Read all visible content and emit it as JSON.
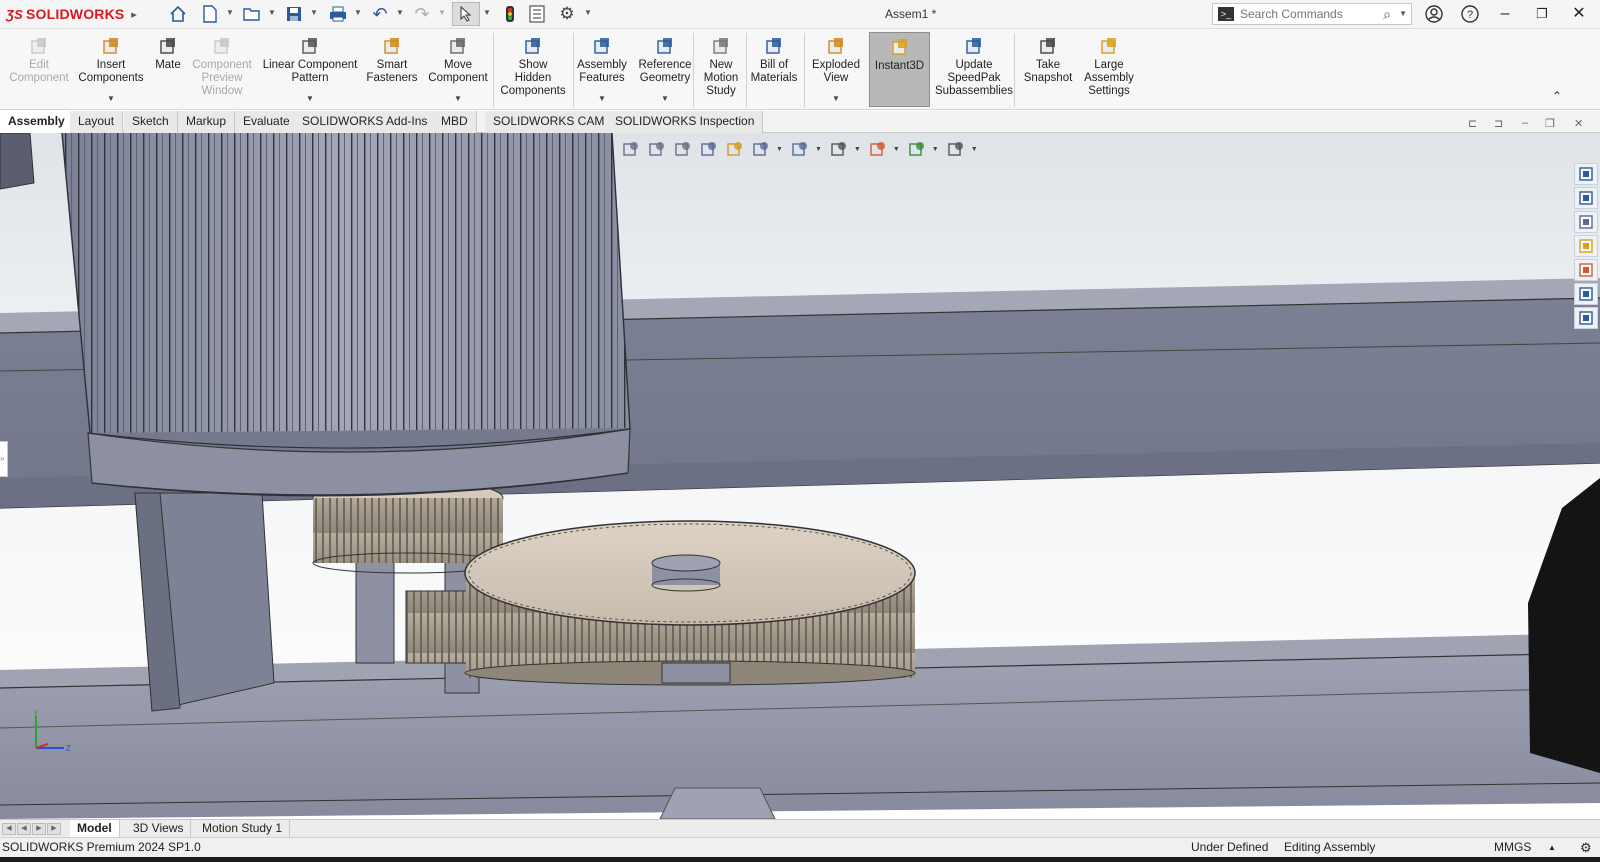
{
  "app": {
    "brand": "SOLIDWORKS",
    "document_title": "Assem1 *"
  },
  "search": {
    "placeholder": "Search Commands"
  },
  "ribbon": {
    "commands": [
      {
        "label": "Edit Component",
        "lines": [
          "Edit",
          "Component"
        ],
        "icon": "edit-component-icon",
        "enabled": false
      },
      {
        "label": "Insert Components",
        "lines": [
          "Insert",
          "Components"
        ],
        "icon": "insert-components-icon",
        "enabled": true,
        "dropdown": true
      },
      {
        "label": "Mate",
        "lines": [
          "Mate"
        ],
        "icon": "mate-icon",
        "enabled": true
      },
      {
        "label": "Component Preview Window",
        "lines": [
          "Component",
          "Preview",
          "Window"
        ],
        "icon": "preview-window-icon",
        "enabled": false
      },
      {
        "label": "Linear Component Pattern",
        "lines": [
          "Linear Component",
          "Pattern"
        ],
        "icon": "linear-pattern-icon",
        "enabled": true,
        "dropdown": true
      },
      {
        "label": "Smart Fasteners",
        "lines": [
          "Smart",
          "Fasteners"
        ],
        "icon": "smart-fasteners-icon",
        "enabled": true
      },
      {
        "label": "Move Component",
        "lines": [
          "Move",
          "Component"
        ],
        "icon": "move-component-icon",
        "enabled": true,
        "dropdown": true
      },
      {
        "label": "Show Hidden Components",
        "lines": [
          "Show",
          "Hidden",
          "Components"
        ],
        "icon": "show-hidden-icon",
        "enabled": true
      },
      {
        "label": "Assembly Features",
        "lines": [
          "Assembly",
          "Features"
        ],
        "icon": "assembly-features-icon",
        "enabled": true,
        "dropdown": true
      },
      {
        "label": "Reference Geometry",
        "lines": [
          "Reference",
          "Geometry"
        ],
        "icon": "reference-geometry-icon",
        "enabled": true,
        "dropdown": true
      },
      {
        "label": "New Motion Study",
        "lines": [
          "New",
          "Motion",
          "Study"
        ],
        "icon": "motion-study-icon",
        "enabled": true
      },
      {
        "label": "Bill of Materials",
        "lines": [
          "Bill of",
          "Materials"
        ],
        "icon": "bill-of-materials-icon",
        "enabled": true
      },
      {
        "label": "Exploded View",
        "lines": [
          "Exploded",
          "View"
        ],
        "icon": "exploded-view-icon",
        "enabled": true,
        "dropdown": true
      },
      {
        "label": "Instant3D",
        "lines": [
          "Instant3D"
        ],
        "icon": "instant3d-icon",
        "enabled": true,
        "active": true
      },
      {
        "label": "Update SpeedPak Subassemblies",
        "lines": [
          "Update",
          "SpeedPak",
          "Subassemblies"
        ],
        "icon": "speedpak-icon",
        "enabled": true
      },
      {
        "label": "Take Snapshot",
        "lines": [
          "Take",
          "Snapshot"
        ],
        "icon": "snapshot-icon",
        "enabled": true
      },
      {
        "label": "Large Assembly Settings",
        "lines": [
          "Large",
          "Assembly",
          "Settings"
        ],
        "icon": "large-assembly-icon",
        "enabled": true
      }
    ]
  },
  "tabs": [
    "Assembly",
    "Layout",
    "Sketch",
    "Markup",
    "Evaluate",
    "SOLIDWORKS Add-Ins",
    "MBD",
    "SOLIDWORKS CAM",
    "SOLIDWORKS Inspection"
  ],
  "active_tab": "Assembly",
  "heads_up_icons": [
    "zoom-to-fit-icon",
    "zoom-to-area-icon",
    "previous-view-icon",
    "section-view-icon",
    "dynamic-annotation-icon",
    "view-orientation-icon",
    "display-style-icon",
    "hide-show-icon",
    "edit-appearance-icon",
    "apply-scene-icon",
    "view-settings-icon"
  ],
  "task_pane_icons": [
    "solidworks-resources-icon",
    "design-library-icon",
    "file-explorer-icon",
    "view-palette-icon",
    "appearances-icon",
    "custom-properties-icon",
    "forum-icon"
  ],
  "triad": {
    "y_label": "Y",
    "z_label": "Z"
  },
  "bottom_tabs": [
    "Model",
    "3D Views",
    "Motion Study 1"
  ],
  "active_bottom_tab": "Model",
  "status": {
    "version": "SOLIDWORKS Premium 2024 SP1.0",
    "definition": "Under Defined",
    "mode": "Editing Assembly",
    "units": "MMGS"
  },
  "colors": {
    "brand_red": "#d71920",
    "frame": "#7d8196",
    "gear": "#cbbfb1",
    "motor": "#8f93a6"
  }
}
